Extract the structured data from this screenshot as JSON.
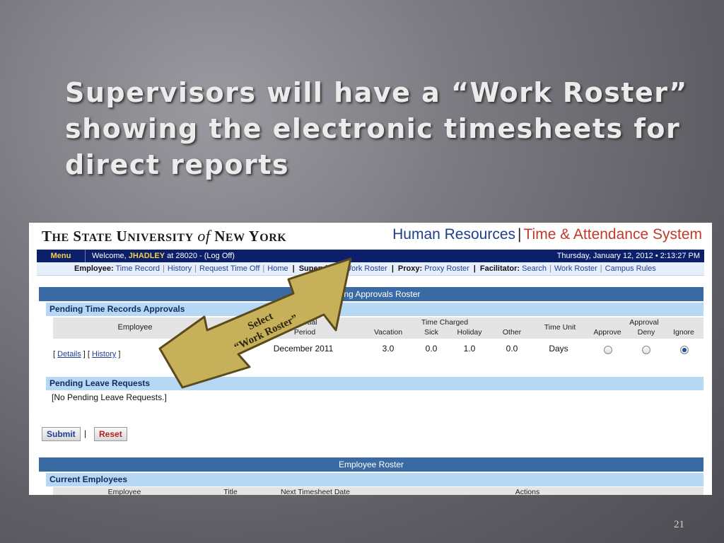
{
  "slide": {
    "title_lines": [
      "Supervisors will have a “Work Roster”",
      "showing the electronic timesheets for",
      "direct reports"
    ],
    "page_number": "21",
    "callout_line1": "Select",
    "callout_line2": "“Work Roster”"
  },
  "header": {
    "logo_the": "T",
    "logo_he": "HE",
    "logo_s": "S",
    "logo_tate": "TATE",
    "logo_u": "U",
    "logo_niversity": "NIVERSITY",
    "logo_of": "of",
    "logo_n": "N",
    "logo_ew": "EW",
    "logo_y": "Y",
    "logo_ork": "ORK",
    "system_left": "Human Resources",
    "system_sep": "|",
    "system_right": "Time & Attendance System"
  },
  "menu_bar": {
    "menu_label": "Menu",
    "welcome_prefix": "Welcome, ",
    "user": "JHADLEY",
    "location": " at 28020 - (Log Off)",
    "datetime": "Thursday, January 12, 2012 • 2:13:27 PM"
  },
  "nav": {
    "employee_label": "Employee:",
    "time_record": "Time Record",
    "history": "History",
    "request_time_off": "Request Time Off",
    "home": "Home",
    "supervisor_label": "Supervisor:",
    "work_roster": "Work Roster",
    "proxy_label": "Proxy:",
    "proxy_roster": "Proxy Roster",
    "facilitator_label": "Facilitator:",
    "search": "Search",
    "fac_work_roster": "Work Roster",
    "campus_rules": "Campus Rules"
  },
  "pending_roster": {
    "header": "Pending Approvals Roster",
    "section_title": "Pending Time Records Approvals",
    "columns": {
      "employee": "Employee",
      "accrual_line1": "Accrual",
      "accrual_line2": "Period",
      "time_charged": "Time Charged",
      "vacation": "Vacation",
      "sick": "Sick",
      "holiday": "Holiday",
      "other": "Other",
      "time_unit": "Time Unit",
      "approval": "Approval",
      "approve": "Approve",
      "deny": "Deny",
      "ignore": "Ignore"
    },
    "row": {
      "details": "Details",
      "history": "History",
      "period": "December 2011",
      "vacation": "3.0",
      "sick": "0.0",
      "holiday": "1.0",
      "other": "0.0",
      "unit": "Days",
      "selected": "ignore"
    }
  },
  "leave": {
    "section_title": "Pending Leave Requests",
    "empty_text": "[No Pending Leave Requests.]"
  },
  "actions": {
    "submit": "Submit",
    "divider": "|",
    "reset": "Reset"
  },
  "employee_roster": {
    "header": "Employee Roster",
    "section_title": "Current Employees",
    "columns": {
      "employee": "Employee",
      "title": "Title",
      "next_date": "Next Timesheet Date",
      "actions": "Actions"
    }
  },
  "colors": {
    "menu_bar": "#0b1f6b",
    "header_blue": "#3a6aa3",
    "section_blue": "#b7d8f5",
    "arrow_fill": "#c7b05a",
    "arrow_stroke": "#5a4a1c"
  }
}
